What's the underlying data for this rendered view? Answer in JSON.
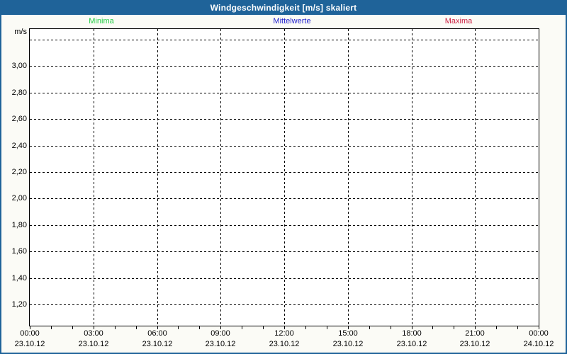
{
  "window": {
    "title": "Windgeschwindigkeit [m/s] skaliert"
  },
  "colors": {
    "titlebar_bg": "#1F6399",
    "frame_border": "#1F6399",
    "background": "#FBFBF6",
    "plot_bg": "#FFFFFF",
    "grid": "#000000",
    "minima": "#22CC44",
    "mittelwerte": "#2222CC",
    "maxima": "#CC2244"
  },
  "chart_data": {
    "type": "line",
    "title": "Windgeschwindigkeit [m/s] skaliert",
    "ylabel": "m/s",
    "grid": "dashed",
    "legend_position": "top",
    "series": [
      {
        "name": "Minima",
        "color": "#22CC44",
        "values": []
      },
      {
        "name": "Mittelwerte",
        "color": "#2222CC",
        "values": []
      },
      {
        "name": "Maxima",
        "color": "#CC2244",
        "values": []
      }
    ],
    "x_axis": {
      "range_hours": [
        0,
        24
      ],
      "major_tick_interval_hours": 3,
      "minor_tick_interval_hours": 1,
      "ticks": [
        {
          "hour": 0,
          "time": "00:00",
          "date": "23.10.12"
        },
        {
          "hour": 3,
          "time": "03:00",
          "date": "23.10.12"
        },
        {
          "hour": 6,
          "time": "06:00",
          "date": "23.10.12"
        },
        {
          "hour": 9,
          "time": "09:00",
          "date": "23.10.12"
        },
        {
          "hour": 12,
          "time": "12:00",
          "date": "23.10.12"
        },
        {
          "hour": 15,
          "time": "15:00",
          "date": "23.10.12"
        },
        {
          "hour": 18,
          "time": "18:00",
          "date": "23.10.12"
        },
        {
          "hour": 21,
          "time": "21:00",
          "date": "23.10.12"
        },
        {
          "hour": 24,
          "time": "00:00",
          "date": "24.10.12"
        }
      ]
    },
    "y_axis": {
      "unit": "m/s",
      "lim": [
        1.04,
        3.28
      ],
      "gridlines": [
        {
          "value": 3.2,
          "label": ""
        },
        {
          "value": 3.0,
          "label": "3,00"
        },
        {
          "value": 2.8,
          "label": "2,80"
        },
        {
          "value": 2.6,
          "label": "2,60"
        },
        {
          "value": 2.4,
          "label": "2,40"
        },
        {
          "value": 2.2,
          "label": "2,20"
        },
        {
          "value": 2.0,
          "label": "2,00"
        },
        {
          "value": 1.8,
          "label": "1,80"
        },
        {
          "value": 1.6,
          "label": "1,60"
        },
        {
          "value": 1.4,
          "label": "1,40"
        },
        {
          "value": 1.2,
          "label": "1,20"
        }
      ]
    }
  }
}
